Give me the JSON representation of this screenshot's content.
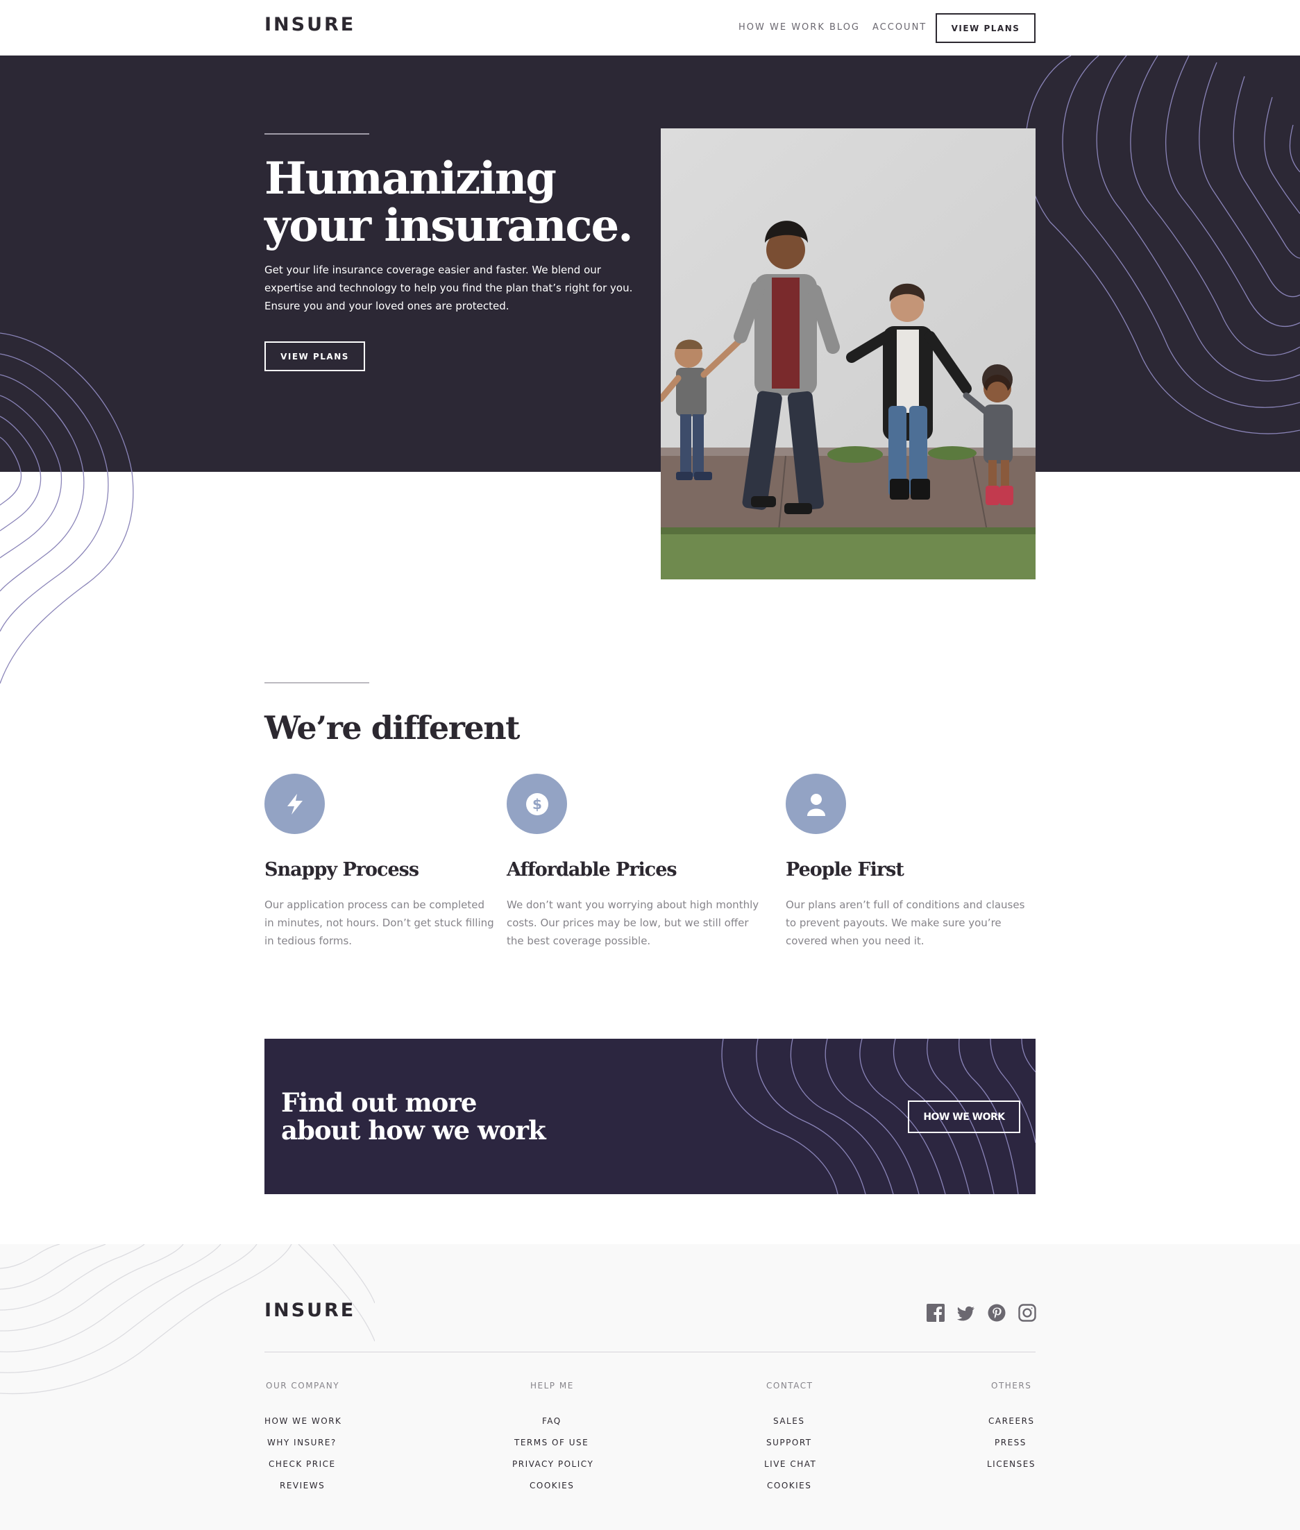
{
  "header": {
    "logo": "INSURE",
    "nav": [
      "HOW WE WORK",
      "BLOG",
      "ACCOUNT"
    ],
    "cta_label": "VIEW PLANS"
  },
  "hero": {
    "title_line1": "Humanizing",
    "title_line2": "your insurance.",
    "text": "Get your life insurance coverage easier and faster. We blend our expertise and technology to help you find the plan that’s right for you. Ensure you and your loved ones are protected.",
    "button_label": "VIEW PLANS"
  },
  "features": {
    "title": "We’re different",
    "items": [
      {
        "icon": "lightning-icon",
        "title": "Snappy Process",
        "text": "Our application process can be completed in minutes, not hours. Don’t get stuck filling in tedious forms."
      },
      {
        "icon": "dollar-icon",
        "title": "Affordable Prices",
        "text": "We don’t want you worrying about high monthly costs. Our prices may be low, but we still offer the best coverage possible."
      },
      {
        "icon": "person-icon",
        "title": "People First",
        "text": "Our plans aren’t full of conditions and clauses to prevent payouts. We make sure you’re covered when you need it."
      }
    ]
  },
  "cta": {
    "title_line1": "Find out more",
    "title_line2": "about how we work",
    "button_label": "HOW WE WORK"
  },
  "footer": {
    "logo": "INSURE",
    "social": [
      "facebook-icon",
      "twitter-icon",
      "pinterest-icon",
      "instagram-icon"
    ],
    "columns": [
      {
        "heading": "OUR COMPANY",
        "links": [
          "HOW WE WORK",
          "WHY INSURE?",
          "CHECK PRICE",
          "REVIEWS"
        ]
      },
      {
        "heading": "HELP ME",
        "links": [
          "FAQ",
          "TERMS OF USE",
          "PRIVACY POLICY",
          "COOKIES"
        ]
      },
      {
        "heading": "CONTACT",
        "links": [
          "SALES",
          "SUPPORT",
          "LIVE CHAT",
          "COOKIES"
        ]
      },
      {
        "heading": "OTHERS",
        "links": [
          "CAREERS",
          "PRESS",
          "LICENSES"
        ]
      }
    ]
  },
  "colors": {
    "dark_violet": "#2c2835",
    "cta_violet": "#2c2640",
    "icon_blue": "#93a3c4",
    "grey_text": "#86848a",
    "footer_bg": "#f9f9f9"
  }
}
